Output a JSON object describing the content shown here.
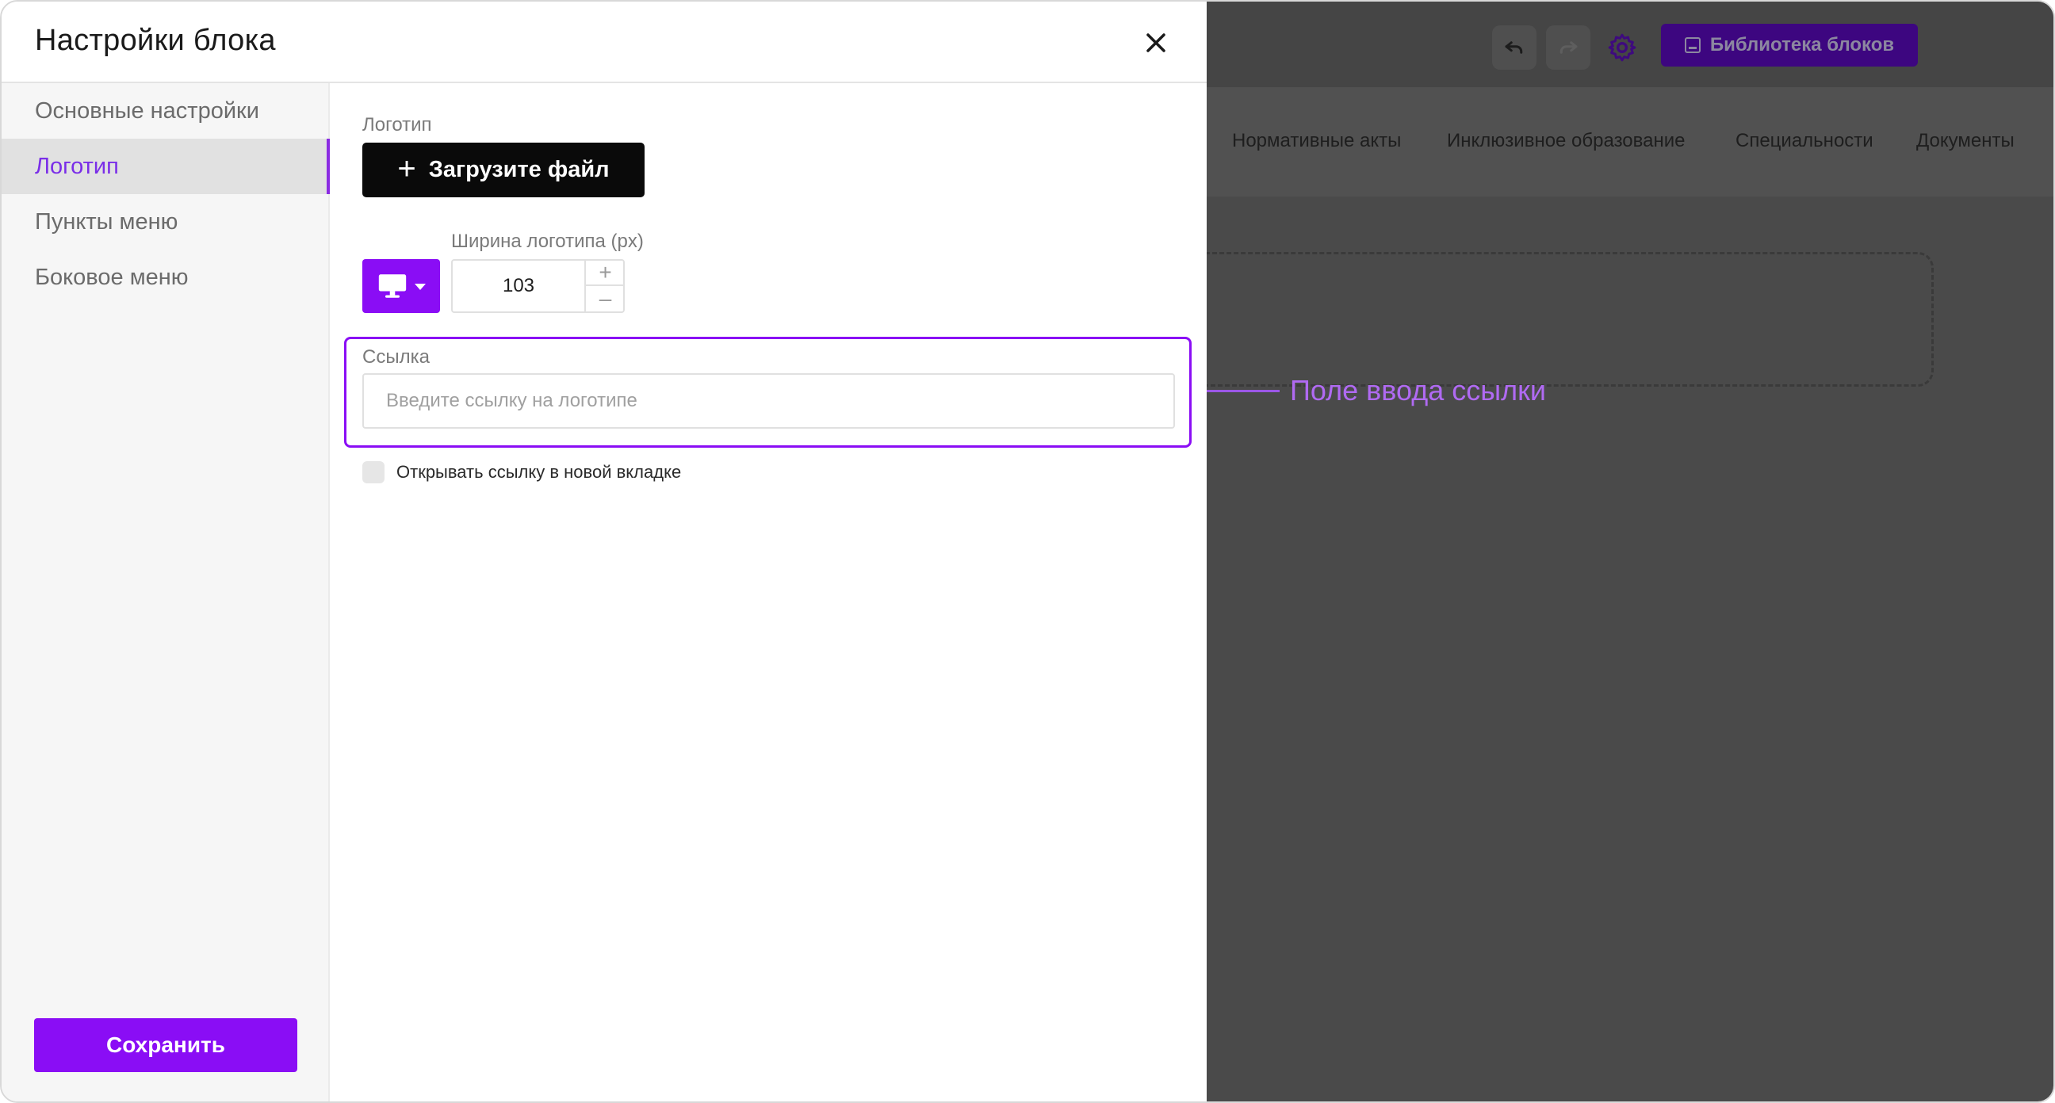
{
  "modal": {
    "title": "Настройки блока",
    "close_icon": "close-icon"
  },
  "sidebar": {
    "items": [
      {
        "label": "Основные настройки",
        "active": false
      },
      {
        "label": "Логотип",
        "active": true
      },
      {
        "label": "Пункты меню",
        "active": false
      },
      {
        "label": "Боковое меню",
        "active": false
      }
    ],
    "save_label": "Сохранить"
  },
  "logo": {
    "section_label": "Логотип",
    "upload_label": "Загрузите файл",
    "upload_icon": "plus-icon",
    "device_icon": "desktop-icon",
    "width_label": "Ширина логотипа (px)",
    "width_value": "103",
    "increment": "+",
    "decrement": "–",
    "link_label": "Ссылка",
    "link_value": "",
    "link_placeholder": "Введите ссылку на логотипе",
    "new_tab_label": "Открывать ссылку в новой вкладке",
    "new_tab_checked": false
  },
  "annotation": {
    "text": "Поле ввода ссылки"
  },
  "background": {
    "library_label": "Библиотека блоков",
    "nav_items": [
      "Нормативные акты",
      "Инклюзивное образование",
      "Специальности",
      "Документы"
    ]
  },
  "colors": {
    "accent": "#8a0df5",
    "active_text": "#7a2ee8",
    "overlay": "#4a4a4a",
    "annotation": "#b06af2"
  }
}
